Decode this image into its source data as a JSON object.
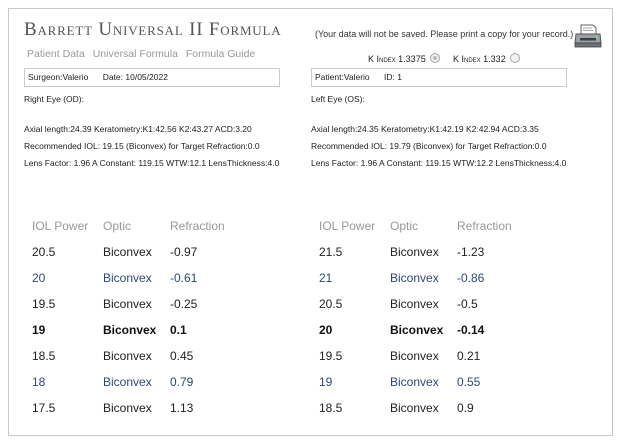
{
  "app": {
    "title": "Barrett Universal II Formula",
    "nav": [
      "Patient Data",
      "Universal Formula",
      "Formula Guide"
    ],
    "save_note": "(Your data will not be saved.  Please print a copy for your record.)"
  },
  "icons": {
    "print": "printer-icon"
  },
  "k_index": [
    {
      "label": "K Index 1.3375",
      "selected": true
    },
    {
      "label": "K Index 1.332",
      "selected": false
    }
  ],
  "right": {
    "info": {
      "surgeon": "Surgeon:Valerio",
      "date": "Date:  10/05/2022"
    },
    "eye_label": "Right Eye (OD):",
    "line1": "Axial length:24.39  Keratometry:K1:42.56 K2:43.27  ACD:3.20",
    "line2": "Recommended IOL: 19.15 (Biconvex) for Target Refraction:0.0",
    "line3": "Lens Factor: 1.96 A Constant: 119.15 WTW:12.1 LensThickness:4.0",
    "headers": [
      "IOL Power",
      "Optic",
      "Refraction"
    ],
    "rows": [
      {
        "power": "20.5",
        "optic": "Biconvex",
        "refraction": "-0.97",
        "style": ""
      },
      {
        "power": "20",
        "optic": "Biconvex",
        "refraction": "-0.61",
        "style": "blue"
      },
      {
        "power": "19.5",
        "optic": "Biconvex",
        "refraction": "-0.25",
        "style": ""
      },
      {
        "power": "19",
        "optic": "Biconvex",
        "refraction": "0.1",
        "style": "sel"
      },
      {
        "power": "18.5",
        "optic": "Biconvex",
        "refraction": "0.45",
        "style": ""
      },
      {
        "power": "18",
        "optic": "Biconvex",
        "refraction": "0.79",
        "style": "blue"
      },
      {
        "power": "17.5",
        "optic": "Biconvex",
        "refraction": "1.13",
        "style": ""
      }
    ]
  },
  "left": {
    "info": {
      "patient": "Patient:Valerio",
      "id": "ID: 1"
    },
    "eye_label": "Left Eye (OS):",
    "line1": "Axial length:24.35  Keratometry:K1:42.19 K2:42.94  ACD:3.35",
    "line2": "Recommended IOL: 19.79 (Biconvex) for Target Refraction:0.0",
    "line3": "Lens Factor: 1.96 A Constant: 119.15 WTW:12.2 LensThickness:4.0",
    "headers": [
      "IOL Power",
      "Optic",
      "Refraction"
    ],
    "rows": [
      {
        "power": "21.5",
        "optic": "Biconvex",
        "refraction": "-1.23",
        "style": ""
      },
      {
        "power": "21",
        "optic": "Biconvex",
        "refraction": "-0.86",
        "style": "blue"
      },
      {
        "power": "20.5",
        "optic": "Biconvex",
        "refraction": "-0.5",
        "style": ""
      },
      {
        "power": "20",
        "optic": "Biconvex",
        "refraction": "-0.14",
        "style": "sel"
      },
      {
        "power": "19.5",
        "optic": "Biconvex",
        "refraction": "0.21",
        "style": ""
      },
      {
        "power": "19",
        "optic": "Biconvex",
        "refraction": "0.55",
        "style": "blue"
      },
      {
        "power": "18.5",
        "optic": "Biconvex",
        "refraction": "0.9",
        "style": ""
      }
    ]
  }
}
